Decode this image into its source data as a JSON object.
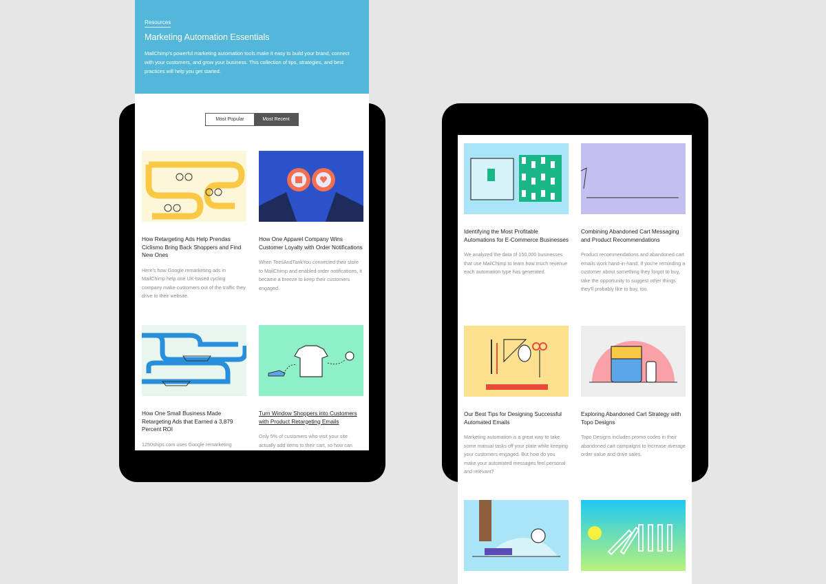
{
  "left": {
    "breadcrumb": "Resources",
    "title": "Marketing Automation Essentials",
    "description": "MailChimp's powerful marketing automation tools make it easy to build your brand, connect with your customers, and grow your business. This collection of tips, strategies, and best practices will help you get started.",
    "tabs": {
      "popular": "Most Popular",
      "recent": "Most Recent",
      "active": "recent"
    },
    "cards": [
      {
        "title": "How Retargeting Ads Help Prendas Ciclismo Bring Back Shoppers and Find New Ones",
        "desc": "Here's how Google remarketing ads in MailChimp help one UK-based cycling company make customers out of the traffic they drive to their website.",
        "thumb_bg": "#fdf6d8"
      },
      {
        "title": "How One Apparel Company Wins Customer Loyalty with Order Notifications",
        "desc": "When TeesAndTankYou connected their store to MailChimp and enabled order notifications, it became a breeze to keep their customers engaged.",
        "thumb_bg": "#2b52c9"
      },
      {
        "title": "How One Small Business Made Retargeting Ads that Earned a 3,879 Percent ROI",
        "desc": "1250ships.com uses Google remarketing",
        "thumb_bg": "#e9f6f0"
      },
      {
        "title": "Turn Window Shoppers into Customers with Product Retargeting Emails",
        "desc": "Only 5% of customers who visit your site actually add items to their cart, so how can",
        "thumb_bg": "#8ef0c8"
      }
    ]
  },
  "right": {
    "cards": [
      {
        "title": "Identifying the Most Profitable Automations for E-Commerce Businesses",
        "desc": "We analyzed the data of 150,000 businesses that use MailChimp to learn how much revenue each automation type has generated.",
        "thumb_bg": "#a9e5f7"
      },
      {
        "title": "Combining Abandoned Cart Messaging and Product Recommendations",
        "desc": "Product recommendations and abandoned cart emails work hand-in-hand. If you're reminding a customer about something they forgot to buy, take the opportunity to suggest other things they'll probably like to buy, too.",
        "thumb_bg": "#c3bff0"
      },
      {
        "title": "Our Best Tips for Designing Successful Automated Emails",
        "desc": "Marketing automation is a great way to take some manual tasks off your plate while keeping your customers engaged. But how do you make your automated messages feel personal and relevant?",
        "thumb_bg": "#fde18f"
      },
      {
        "title": "Exploring Abandoned Cart Strategy with Topo Designs",
        "desc": "Topo Designs includes promo codes in their abandoned cart campaigns to increase average order value and drive sales.",
        "thumb_bg": "#eeeeee"
      }
    ],
    "thumbs_bottom": [
      {
        "thumb_bg": "#a9e5f7"
      },
      {
        "thumb_bg": "#1ec9f2"
      }
    ]
  }
}
